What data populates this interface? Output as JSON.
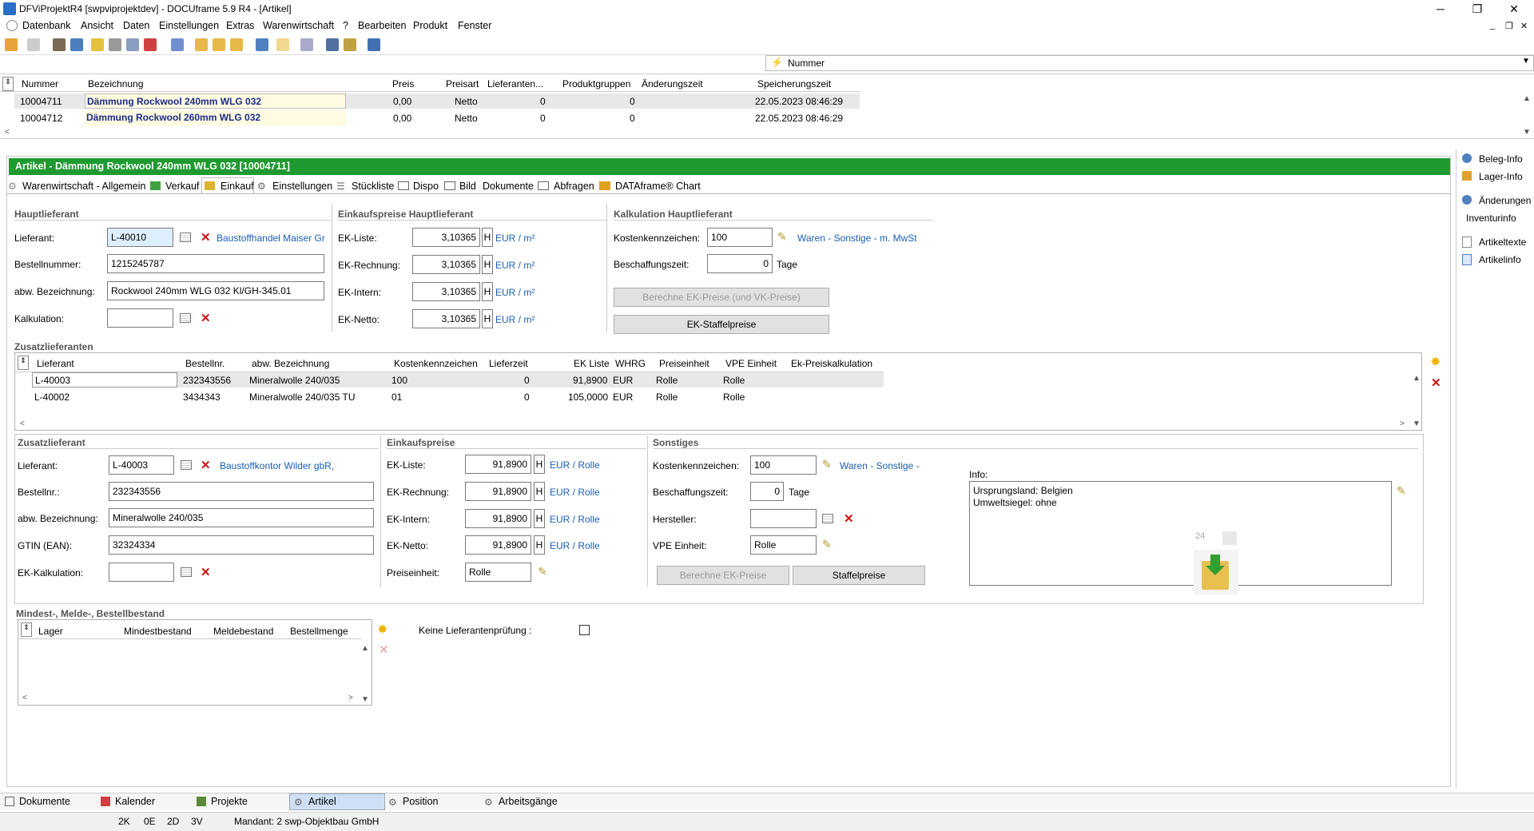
{
  "window": {
    "title": "DFViProjektR4 [swpviprojektdev] - DOCUframe 5.9 R4 - [Artikel]"
  },
  "menu": [
    "Datenbank",
    "Ansicht",
    "Daten",
    "Einstellungen",
    "Extras",
    "Warenwirtschaft",
    "?",
    "Bearbeiten",
    "Produkt",
    "Fenster"
  ],
  "filter": {
    "field": "Nummer"
  },
  "top_grid": {
    "headers": [
      "Nummer",
      "Bezeichnung",
      "Preis",
      "Preisart",
      "Lieferanten...",
      "Produktgruppen",
      "Änderungszeit",
      "Speicherungszeit"
    ],
    "rows": [
      {
        "nummer": "10004711",
        "bezeichnung": "Dämmung Rockwool 240mm WLG 032",
        "preis": "0,00",
        "preisart": "Netto",
        "lieferanten": "0",
        "produktgruppen": "0",
        "aenderung": "",
        "speicherung": "22.05.2023 08:46:29"
      },
      {
        "nummer": "10004712",
        "bezeichnung": "Dämmung Rockwool 260mm WLG 032",
        "preis": "0,00",
        "preisart": "Netto",
        "lieferanten": "0",
        "produktgruppen": "0",
        "aenderung": "",
        "speicherung": "22.05.2023 08:46:29"
      }
    ]
  },
  "header_bar": "Artikel  -  Dämmung Rockwool 240mm WLG 032 [10004711]",
  "tabs": [
    "Warenwirtschaft - Allgemein",
    "Verkauf",
    "Einkauf",
    "Einstellungen",
    "Stückliste",
    "Dispo",
    "Bild",
    "Dokumente",
    "Abfragen",
    "DATAframe® Chart"
  ],
  "haupt": {
    "title": "Hauptlieferant",
    "lieferant_label": "Lieferant:",
    "lieferant": "L-40010",
    "lieferant_name": "Baustoffhandel Maiser Gr",
    "bestellnr_label": "Bestellnummer:",
    "bestellnr": "1215245787",
    "abw_label": "abw. Bezeichnung:",
    "abw": "Rockwool 240mm WLG 032 Kl/GH-345.01",
    "kalk_label": "Kalkulation:",
    "kalk": ""
  },
  "ekpreise": {
    "title": "Einkaufspreise Hauptlieferant",
    "rows": [
      {
        "label": "EK-Liste:",
        "value": "3,10365",
        "h": "H",
        "unit": "EUR / m²"
      },
      {
        "label": "EK-Rechnung:",
        "value": "3,10365",
        "h": "H",
        "unit": "EUR / m²"
      },
      {
        "label": "EK-Intern:",
        "value": "3,10365",
        "h": "H",
        "unit": "EUR / m²"
      },
      {
        "label": "EK-Netto:",
        "value": "3,10365",
        "h": "H",
        "unit": "EUR / m²"
      }
    ]
  },
  "kalkulation": {
    "title": "Kalkulation Hauptlieferant",
    "kk_label": "Kostenkennzeichen:",
    "kk": "100",
    "kk_text": "Waren - Sonstige - m. MwSt",
    "bz_label": "Beschaffungszeit:",
    "bz": "0",
    "bz_unit": "Tage",
    "btn1": "Berechne EK-Preise (und VK-Preise)",
    "btn2": "EK-Staffelpreise"
  },
  "zusatz_grid": {
    "title": "Zusatzlieferanten",
    "headers": [
      "Lieferant",
      "Bestellnr.",
      "abw. Bezeichnung",
      "Kostenkennzeichen",
      "Lieferzeit",
      "EK Liste",
      "WHRG",
      "Preiseinheit",
      "VPE Einheit",
      "Ek-Preiskalkulation"
    ],
    "rows": [
      [
        "L-40003",
        "232343556",
        "Mineralwolle 240/035",
        "100",
        "0",
        "91,8900",
        "EUR",
        "Rolle",
        "Rolle",
        ""
      ],
      [
        "L-40002",
        "3434343",
        "Mineralwolle 240/035 TU",
        "01",
        "0",
        "105,0000",
        "EUR",
        "Rolle",
        "Rolle",
        ""
      ]
    ]
  },
  "zusatz": {
    "title": "Zusatzlieferant",
    "lieferant_label": "Lieferant:",
    "lieferant": "L-40003",
    "lieferant_name": "Baustoffkontor Wilder gbR,",
    "bestellnr_label": "Bestellnr.:",
    "bestellnr": "232343556",
    "abw_label": "abw. Bezeichnung:",
    "abw": "Mineralwolle 240/035",
    "gtin_label": "GTIN (EAN):",
    "gtin": "32324334",
    "ekk_label": "EK-Kalkulation:",
    "ekk": ""
  },
  "ek2": {
    "title": "Einkaufspreise",
    "rows": [
      {
        "label": "EK-Liste:",
        "value": "91,8900",
        "h": "H",
        "unit": "EUR / Rolle"
      },
      {
        "label": "EK-Rechnung:",
        "value": "91,8900",
        "h": "H",
        "unit": "EUR / Rolle"
      },
      {
        "label": "EK-Intern:",
        "value": "91,8900",
        "h": "H",
        "unit": "EUR / Rolle"
      },
      {
        "label": "EK-Netto:",
        "value": "91,8900",
        "h": "H",
        "unit": "EUR / Rolle"
      }
    ],
    "pe_label": "Preiseinheit:",
    "pe": "Rolle"
  },
  "sonstiges": {
    "title": "Sonstiges",
    "kk_label": "Kostenkennzeichen:",
    "kk": "100",
    "kk_text": "Waren - Sonstige -",
    "bz_label": "Beschaffungszeit:",
    "bz": "0",
    "bz_unit": "Tage",
    "hersteller_label": "Hersteller:",
    "hersteller": "",
    "vpe_label": "VPE Einheit:",
    "vpe": "Rolle",
    "btn1": "Berechne EK-Preise",
    "btn2": "Staffelpreise",
    "info_label": "Info:",
    "info_line1": "Ursprungsland: Belgien",
    "info_line2": "Umweltsiegel: ohne",
    "badge": "24"
  },
  "bestand": {
    "title": "Mindest-, Melde-, Bestellbestand",
    "headers": [
      "Lager",
      "Mindestbestand",
      "Meldebestand",
      "Bestellmenge"
    ],
    "keine_label": "Keine Lieferantenprüfung :"
  },
  "sidebar": [
    "Beleg-Info",
    "Lager-Info",
    "Änderungen",
    "Inventurinfo",
    "Artikeltexte",
    "Artikelinfo"
  ],
  "bottom_tabs": [
    "Dokumente",
    "Kalender",
    "Projekte",
    "Artikel",
    "Position",
    "Arbeitsgänge"
  ],
  "status": {
    "a": "2K",
    "b": "0E",
    "c": "2D",
    "d": "3V",
    "mandant": "Mandant: 2 swp-Objektbau GmbH"
  }
}
